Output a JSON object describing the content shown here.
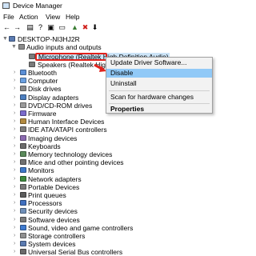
{
  "window": {
    "title": "Device Manager"
  },
  "menu": [
    "File",
    "Action",
    "View",
    "Help"
  ],
  "toolbar": [
    {
      "name": "back-icon",
      "glyph": "←"
    },
    {
      "name": "forward-icon",
      "glyph": "→"
    },
    {
      "name": "properties-icon",
      "glyph": "▤"
    },
    {
      "name": "help-icon",
      "glyph": "?"
    },
    {
      "name": "scan-icon",
      "glyph": "▣"
    },
    {
      "name": "monitor-icon",
      "glyph": "▭"
    },
    {
      "name": "update-driver-icon",
      "glyph": "▲"
    },
    {
      "name": "uninstall-icon",
      "glyph": "✖"
    },
    {
      "name": "disable-icon",
      "glyph": "⬇"
    }
  ],
  "tree": {
    "root": "DESKTOP-NI3HJ2R",
    "expanded_category": "Audio inputs and outputs",
    "children": [
      "Microphone (Realtek High Definition Audio)",
      "Speakers (Realtek High Definition Audio)"
    ],
    "categories": [
      "Bluetooth",
      "Computer",
      "Disk drives",
      "Display adapters",
      "DVD/CD-ROM drives",
      "Firmware",
      "Human Interface Devices",
      "IDE ATA/ATAPI controllers",
      "Imaging devices",
      "Keyboards",
      "Memory technology devices",
      "Mice and other pointing devices",
      "Monitors",
      "Network adapters",
      "Portable Devices",
      "Print queues",
      "Processors",
      "Security devices",
      "Software devices",
      "Sound, video and game controllers",
      "Storage controllers",
      "System devices",
      "Universal Serial Bus controllers"
    ]
  },
  "context_menu": {
    "items": [
      "Update Driver Software...",
      "Disable",
      "Uninstall",
      "Scan for hardware changes",
      "Properties"
    ],
    "highlighted": "Disable"
  },
  "colors": {
    "selection": "#cce4f7",
    "menu_highlight": "#91c9f7",
    "annotation_red": "#e0221c"
  }
}
